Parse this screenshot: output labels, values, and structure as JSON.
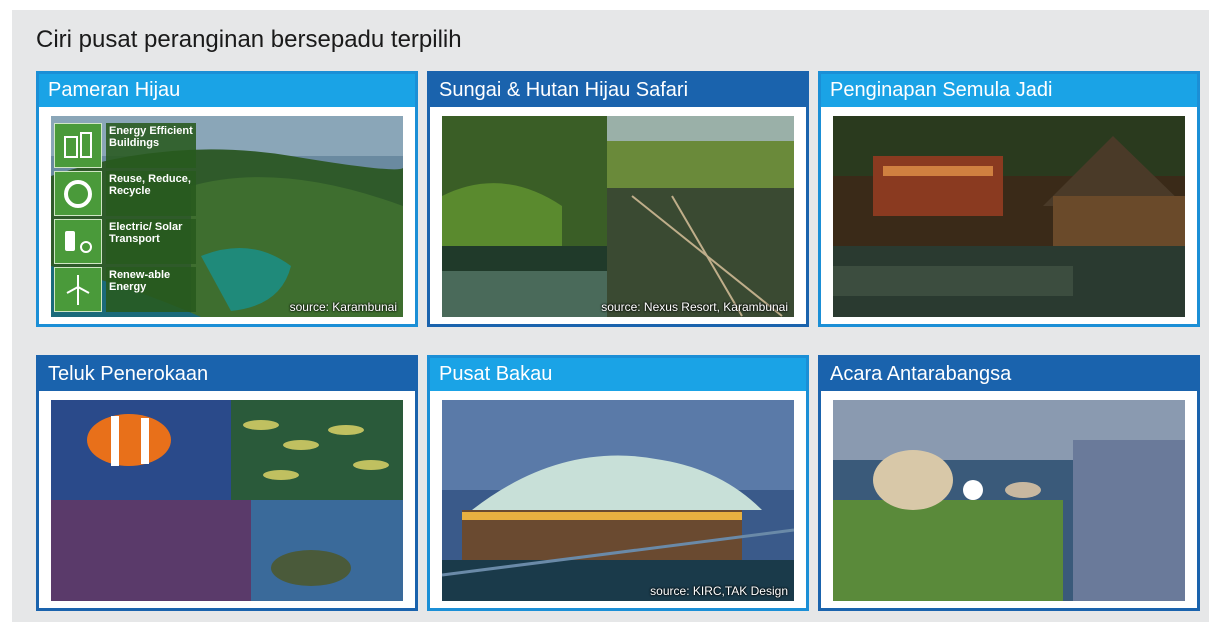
{
  "heading": "Ciri pusat peranginan bersepadu terpilih",
  "cards": [
    {
      "title": "Pameran Hijau",
      "source": "source: Karambunai"
    },
    {
      "title": "Sungai & Hutan Hijau Safari",
      "source": "source: Nexus Resort, Karambunai"
    },
    {
      "title": "Penginapan Semula Jadi",
      "source": ""
    },
    {
      "title": "Teluk Penerokaan",
      "source": ""
    },
    {
      "title": "Pusat Bakau",
      "source": "source: KIRC,TAK Design"
    },
    {
      "title": "Acara Antarabangsa",
      "source": ""
    }
  ],
  "green_legend": [
    {
      "label": "Energy Efficient Buildings",
      "icon": "building-energy-icon"
    },
    {
      "label": "Reuse, Reduce, Recycle",
      "icon": "recycle-icon"
    },
    {
      "label": "Electric/ Solar Transport",
      "icon": "transport-icon"
    },
    {
      "label": "Renew-able Energy",
      "icon": "wind-turbine-icon"
    }
  ],
  "colors": {
    "light_blue": "#1aa3e6",
    "dark_blue": "#1a63ad",
    "panel": "#e6e7e8",
    "legend_green": "#4a9a3a"
  }
}
